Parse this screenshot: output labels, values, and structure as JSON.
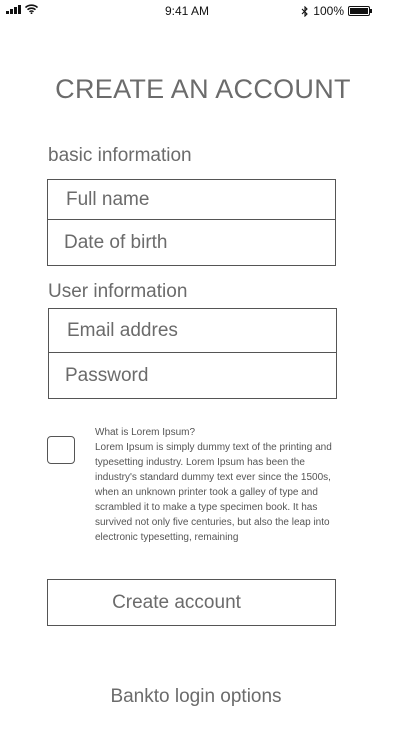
{
  "status_bar": {
    "time": "9:41 AM",
    "battery": "100%",
    "icons": [
      "signal-icon",
      "wifi-icon",
      "bluetooth-icon",
      "battery-icon"
    ]
  },
  "title": "CREATE AN ACCOUNT",
  "basic_section": {
    "label": "basic information",
    "full_name_placeholder": "Full name",
    "dob_placeholder": "Date of birth"
  },
  "user_section": {
    "label": "User information",
    "email_placeholder": "Email addres",
    "password_placeholder": "Password"
  },
  "terms": {
    "heading": "What is Lorem Ipsum?",
    "body": "Lorem Ipsum is simply dummy text of the printing and typesetting industry. Lorem Ipsum has been the industry's standard dummy text ever since the 1500s, when an unknown printer took a galley of type and scrambled it to make a type specimen book. It has survived not only five centuries, but also the leap into electronic typesetting, remaining",
    "checked": false
  },
  "create_button_label": "Create account",
  "login_options_label": "Bankto login options",
  "colors": {
    "text": "#6b6b6b",
    "border": "#555555",
    "background": "#ffffff"
  }
}
